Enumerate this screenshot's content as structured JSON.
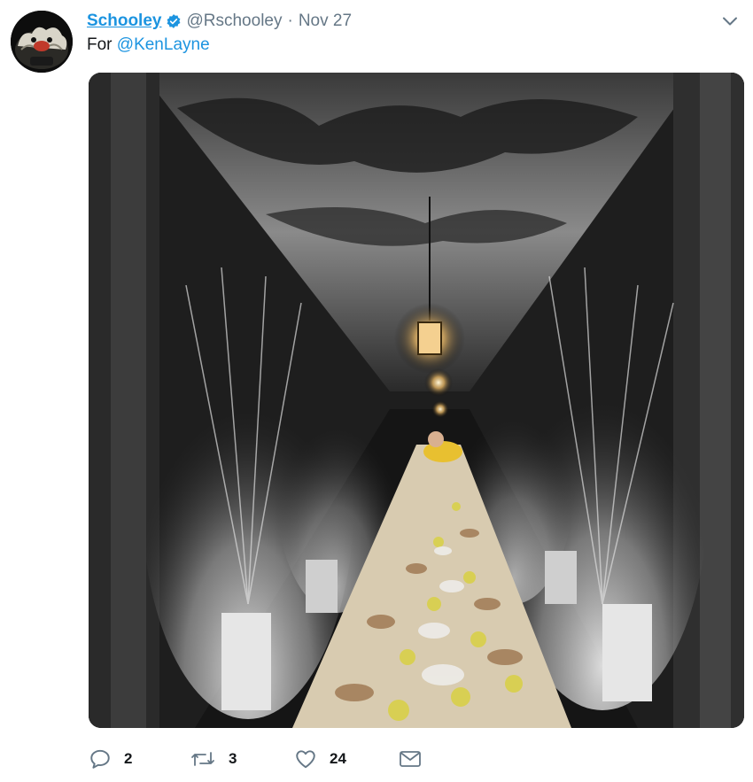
{
  "tweet": {
    "display_name": "Schooley",
    "handle": "@Rschooley",
    "separator": "·",
    "date": "Nov 27",
    "text_prefix": "For",
    "mention": "@KenLayne"
  },
  "actions": {
    "reply_count": "2",
    "retweet_count": "3",
    "like_count": "24"
  },
  "icons": {
    "verified": "verified-badge-icon",
    "caret": "chevron-down-icon",
    "reply": "reply-icon",
    "retweet": "retweet-icon",
    "like": "heart-icon",
    "message": "envelope-icon"
  },
  "colors": {
    "accent": "#1c94e0",
    "secondary_text": "#657786",
    "primary_text": "#14171a"
  }
}
